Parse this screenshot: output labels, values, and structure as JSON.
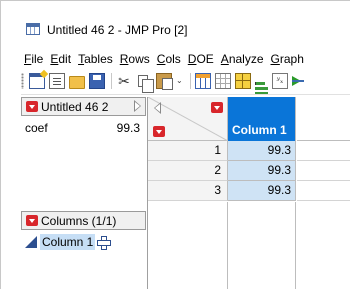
{
  "window": {
    "title": "Untitled 46 2 - JMP Pro [2]",
    "icon": "data-table-icon"
  },
  "menu": [
    {
      "label": "File",
      "ul": "F",
      "rest": "ile"
    },
    {
      "label": "Edit",
      "ul": "E",
      "rest": "dit"
    },
    {
      "label": "Tables",
      "ul": "T",
      "rest": "ables"
    },
    {
      "label": "Rows",
      "ul": "R",
      "rest": "ows"
    },
    {
      "label": "Cols",
      "ul": "C",
      "rest": "ols"
    },
    {
      "label": "DOE",
      "ul": "D",
      "rest": "OE"
    },
    {
      "label": "Analyze",
      "ul": "A",
      "rest": "nalyze"
    },
    {
      "label": "Graph",
      "ul": "G",
      "rest": "raph"
    }
  ],
  "toolbar": {
    "icons": [
      "new-data-table-icon",
      "new-script-icon",
      "open-icon",
      "save-icon",
      "cut-icon",
      "copy-icon",
      "paste-icon",
      "more-icon",
      "data-table-list-icon",
      "grid-icon",
      "tile-icon",
      "distribution-icon",
      "fit-y-by-x-icon",
      "fit-model-icon"
    ],
    "cut_glyph": "✂",
    "more_glyph": "⌄",
    "fit_glyph": "ʸₓ"
  },
  "table_panel": {
    "title": "Untitled 46 2",
    "variables": [
      {
        "name": "coef",
        "value": "99.3"
      }
    ]
  },
  "columns_panel": {
    "title": "Columns (1/1)",
    "columns": [
      {
        "name": "Column 1",
        "type": "continuous"
      }
    ]
  },
  "grid": {
    "columns": [
      "Column 1"
    ],
    "rows": [
      {
        "num": "1",
        "values": [
          "99.3"
        ]
      },
      {
        "num": "2",
        "values": [
          "99.3"
        ]
      },
      {
        "num": "3",
        "values": [
          "99.3"
        ]
      }
    ],
    "selected_column_color": "#0a75d8",
    "selected_cell_color": "#cfe3f5"
  }
}
